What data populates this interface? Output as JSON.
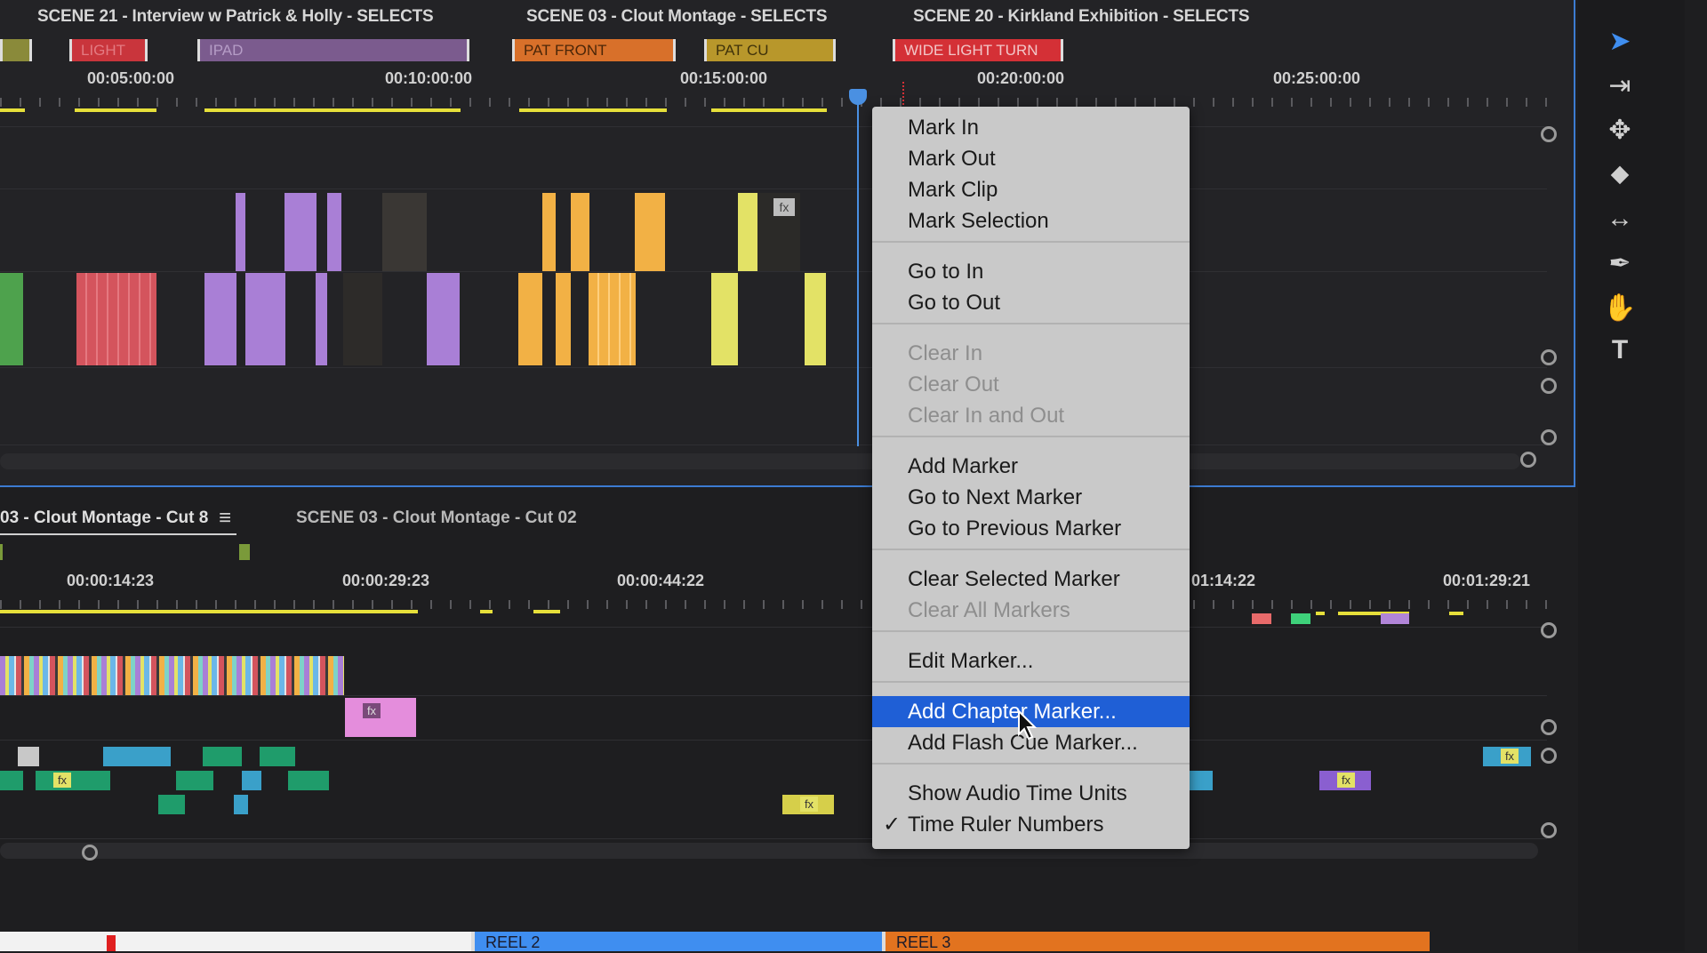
{
  "top_timeline": {
    "scene_titles": [
      "SCENE 21 - Interview w Patrick & Holly - SELECTS",
      "SCENE 03 - Clout Montage - SELECTS",
      "SCENE 20 - Kirkland Exhibition - SELECTS"
    ],
    "markers": [
      {
        "label": "LIGHT",
        "color": "#c9353c"
      },
      {
        "label": "IPAD",
        "color": "#7b5b8e"
      },
      {
        "label": "PAT FRONT",
        "color": "#d8702a"
      },
      {
        "label": "PAT CU",
        "color": "#b8972b"
      },
      {
        "label": "WIDE LIGHT TURN",
        "color": "#d43036"
      }
    ],
    "ruler_labels": [
      "00:05:00:00",
      "00:10:00:00",
      "00:15:00:00",
      "00:20:00:00",
      "00:25:00:00"
    ]
  },
  "tools": [
    {
      "name": "selection-tool-icon",
      "glyph": "➤"
    },
    {
      "name": "track-select-icon",
      "glyph": "⇥"
    },
    {
      "name": "ripple-edit-icon",
      "glyph": "✥"
    },
    {
      "name": "razor-icon",
      "glyph": "⬥"
    },
    {
      "name": "slip-icon",
      "glyph": "↔"
    },
    {
      "name": "pen-icon",
      "glyph": "✒"
    },
    {
      "name": "hand-icon",
      "glyph": "✋"
    },
    {
      "name": "type-icon",
      "glyph": "T"
    }
  ],
  "bottom_timeline": {
    "tabs": [
      "03 - Clout Montage - Cut 8",
      "SCENE 03 - Clout Montage - Cut 02"
    ],
    "ruler_labels": [
      "00:00:14:23",
      "00:00:29:23",
      "00:00:44:22",
      "01:14:22",
      "00:01:29:21"
    ]
  },
  "context_menu": {
    "groups": [
      [
        {
          "label": "Mark In"
        },
        {
          "label": "Mark Out"
        },
        {
          "label": "Mark Clip"
        },
        {
          "label": "Mark Selection"
        }
      ],
      [
        {
          "label": "Go to In"
        },
        {
          "label": "Go to Out"
        }
      ],
      [
        {
          "label": "Clear In",
          "disabled": true
        },
        {
          "label": "Clear Out",
          "disabled": true
        },
        {
          "label": "Clear In and Out",
          "disabled": true
        }
      ],
      [
        {
          "label": "Add Marker"
        },
        {
          "label": "Go to Next Marker"
        },
        {
          "label": "Go to Previous Marker"
        }
      ],
      [
        {
          "label": "Clear Selected Marker"
        },
        {
          "label": "Clear All Markers",
          "disabled": true
        }
      ],
      [
        {
          "label": "Edit Marker..."
        }
      ],
      [
        {
          "label": "Add Chapter Marker...",
          "selected": true
        },
        {
          "label": "Add Flash Cue Marker..."
        }
      ],
      [
        {
          "label": "Show Audio Time Units"
        },
        {
          "label": "Time Ruler Numbers",
          "checked": true
        }
      ]
    ],
    "check_glyph": "✓",
    "selection_color": "#1f5fd6"
  },
  "reels": [
    {
      "label": "REEL 2",
      "color": "#3f8ef0"
    },
    {
      "label": "REEL 3",
      "color": "#e2731f"
    }
  ],
  "clip_fx_label": "fx",
  "menu_icon_glyph": "≡"
}
